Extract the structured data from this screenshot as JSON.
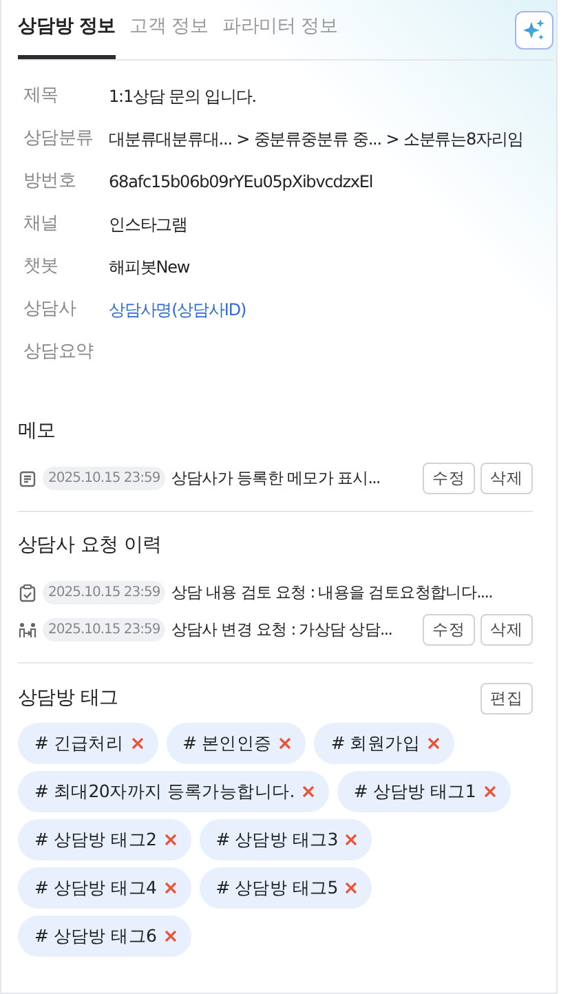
{
  "tabs": [
    {
      "label": "상담방 정보",
      "selected": true
    },
    {
      "label": "고객 정보",
      "selected": false
    },
    {
      "label": "파라미터 정보",
      "selected": false
    }
  ],
  "info": [
    {
      "label": "제목",
      "value": "1:1상담 문의 입니다.",
      "kind": "text"
    },
    {
      "label": "상담분류",
      "value": "대분류대분류대...  > 중분류중분류 중... > 소분류는8자리임",
      "kind": "text"
    },
    {
      "label": "방번호",
      "value": "68afc15b06b09rYEu05pXibvcdzxEl",
      "kind": "text"
    },
    {
      "label": "채널",
      "value": "인스타그램",
      "kind": "text"
    },
    {
      "label": "챗봇",
      "value": "해피봇New",
      "kind": "text"
    },
    {
      "label": "상담사",
      "value": "상담사명(상담사ID)",
      "kind": "link"
    },
    {
      "label": "상담요약"
    }
  ],
  "memo": {
    "title": "메모",
    "items": [
      {
        "kind": "memo",
        "date": "2025.10.15 23:59",
        "text": "상담사가 등록한 메모가 표시...",
        "buttons": [
          "수정",
          "삭제"
        ]
      }
    ]
  },
  "history": {
    "title": "상담사 요청 이력",
    "items": [
      {
        "kind": "review",
        "date": "2025.10.15 23:59",
        "text": "상담 내용 검토 요청 : 내용을 검토요청합니다...."
      },
      {
        "kind": "transfer",
        "date": "2025.10.15 23:59",
        "text": "상담사 변경 요청 : 가상담 상담...",
        "buttons": [
          "수정",
          "삭제"
        ]
      }
    ]
  },
  "tags": {
    "title": "상담방 태그",
    "edit_button": "편집",
    "items": [
      {
        "label": "# 긴급처리"
      },
      {
        "label": "# 본인인증"
      },
      {
        "label": "# 회원가입"
      },
      {
        "label": "# 최대20자까지 등록가능합니다."
      },
      {
        "label": "# 상담방 태그1"
      },
      {
        "label": "# 상담방 태그2"
      },
      {
        "label": "# 상담방 태그3"
      },
      {
        "label": "# 상담방 태그4"
      },
      {
        "label": "# 상담방 태그5"
      },
      {
        "label": "# 상담방 태그6"
      }
    ]
  }
}
